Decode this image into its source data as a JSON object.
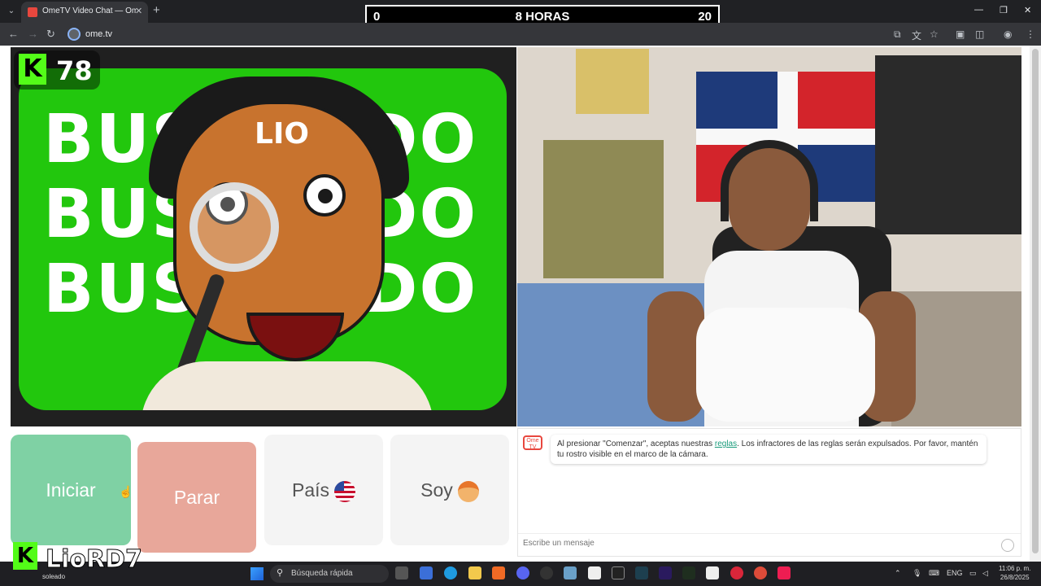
{
  "browser": {
    "tab_title": "OmeTV Video Chat — Ome",
    "url": "ome.tv"
  },
  "scoreboard": {
    "left": "0",
    "center": "8 HORAS",
    "right": "20"
  },
  "left_video": {
    "viewer_count": "78",
    "kick_logo": "K",
    "banner_lines": [
      "BUSCANDO",
      "BUSCANDO",
      "BUSCANDO"
    ],
    "hat_text": "LIO"
  },
  "controls": {
    "start": "Iniciar",
    "stop": "Parar",
    "country": "País",
    "gender": "Soy"
  },
  "chat": {
    "logo_text": "Ome TV",
    "message_before": "Al presionar \"Comenzar\", aceptas nuestras ",
    "message_link": "reglas",
    "message_after": ". Los infractores de las reglas serán expulsados. Por favor, mantén tu rostro visible en el marco de la cámara.",
    "input_placeholder": "Escribe un mensaje"
  },
  "streamer": {
    "name": "LioRD7",
    "logo": "K"
  },
  "taskbar": {
    "weather": "soleado",
    "search_text": "Búsqueda rápida",
    "lang": "ENG",
    "time": "11:06 p. m.",
    "date": "26/8/2025"
  },
  "colors": {
    "kick_green": "#53fc18",
    "start_button": "#7fd1a4",
    "stop_button": "#e8a79a"
  }
}
